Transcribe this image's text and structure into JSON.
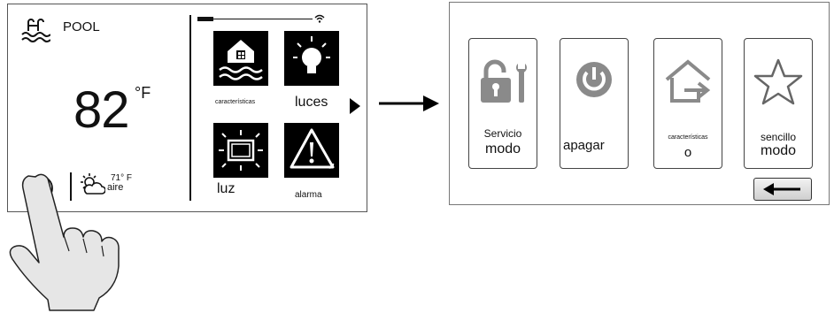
{
  "home_screen": {
    "pool_label": "POOL",
    "temperature": "82",
    "temp_unit": "°F",
    "air_temp": "71° F",
    "air_label": "aire",
    "tiles": [
      {
        "label": "características",
        "icon": "house-water-icon"
      },
      {
        "label": "luces",
        "icon": "light-bulb-icon"
      },
      {
        "label": "luz",
        "icon": "light-panel-icon"
      },
      {
        "label": "alarma",
        "icon": "warning-icon"
      }
    ],
    "next_icon": "play-arrow-icon",
    "power_icon": "power-icon",
    "weather_icon": "partly-sunny-icon",
    "wifi_icon": "wifi-icon"
  },
  "arrow_icon": "right-arrow-icon",
  "menu_screen": {
    "cards": [
      {
        "line1": "Servicio",
        "line2": "modo",
        "icon": "lock-wrench-icon"
      },
      {
        "line1": "apagar",
        "line2": "",
        "icon": "power-icon"
      },
      {
        "line1": "características",
        "line2": "o",
        "icon": "house-exit-icon"
      },
      {
        "line1": "sencillo",
        "line2": "modo",
        "icon": "star-icon"
      }
    ],
    "back_icon": "left-arrow-icon"
  },
  "colors": {
    "accent": "#8a8a8a",
    "tile_bg": "#000000",
    "hand_fill": "#e6e6e6"
  }
}
